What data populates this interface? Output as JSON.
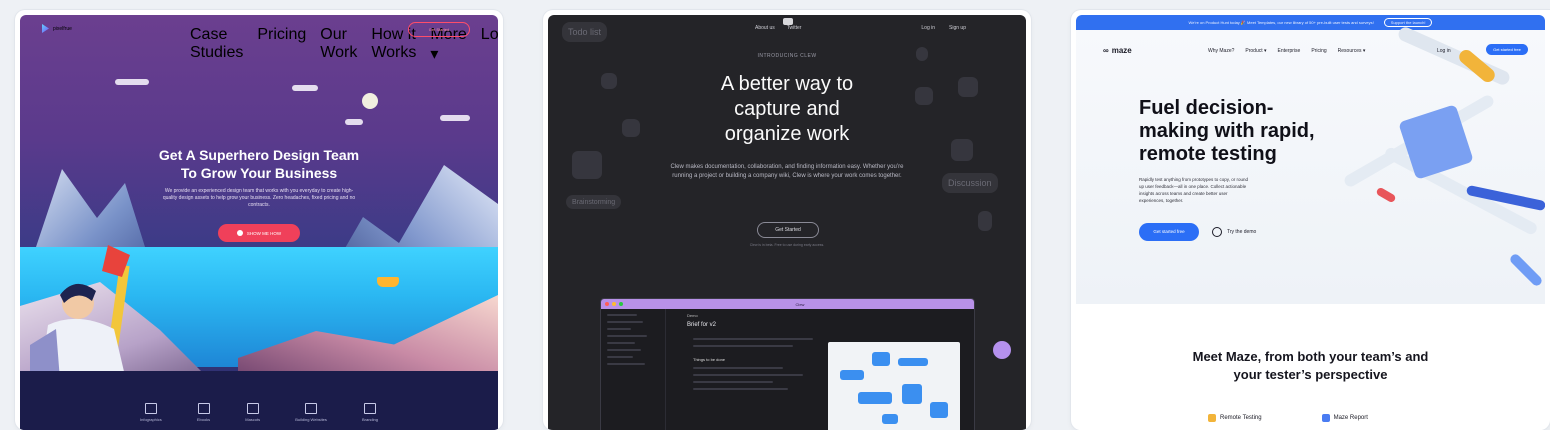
{
  "card1": {
    "logo": "pixelfrue",
    "nav": [
      "Case Studies",
      "Pricing",
      "Our Work",
      "How it Works",
      "More ▾",
      "Login"
    ],
    "nav_cta": "Get Started",
    "headline_1": "Get A Superhero Design Team",
    "headline_2": "To Grow Your Business",
    "subtext": "We provide an experienced design team that works with you everyday to create high-quality design assets to help grow your business. Zero headaches, fixed pricing and no contracts.",
    "cta": "SHOW ME HOW",
    "footer_items": [
      "Infographics",
      "Ebooks",
      "Mascots",
      "Building Websites",
      "Branding"
    ]
  },
  "card2": {
    "top_links": [
      "About us",
      "Twitter"
    ],
    "top_right": [
      "Log in",
      "Sign up"
    ],
    "intro": "INTRODUCING CLEW",
    "headline_1": "A better way to",
    "headline_2": "capture and",
    "headline_3": "organize work",
    "subtext": "Clew makes documentation, collaboration, and finding information easy. Whether you’re running a project or building a company wiki, Clew is where your work comes together.",
    "cta": "Get Started",
    "note": "Clew is in beta. Free to use during early access.",
    "float_pill_1": "Todo list",
    "float_pill_2": "Discussion",
    "float_pill_3": "Brainstorming",
    "app_title": "Clew",
    "app_brief": "Brief for v2",
    "app_subtitle": "Demo",
    "app_things": "Things to be done"
  },
  "card3": {
    "banner_text": "We’re on Product Hunt today 🎉 Meet Templates, our new library of 50+ pre-built user tests and surveys!",
    "banner_button": "Support the launch!",
    "logo": "maze",
    "nav": [
      "Why Maze?",
      "Product ▾",
      "Enterprise",
      "Pricing",
      "Resources ▾"
    ],
    "login": "Log in",
    "nav_cta": "Get started free",
    "headline_1": "Fuel decision-",
    "headline_2": "making with rapid,",
    "headline_3": "remote testing",
    "subtext": "Rapidly test anything from prototypes to copy, or round up user feedback—all in one place. Collect actionable insights across teams and create better user experiences, together.",
    "cta": "Get started free",
    "demo": "Try the demo",
    "section_title_1": "Meet Maze, from both your team’s and",
    "section_title_2": "your tester’s perspective",
    "tabs": [
      "Remote Testing",
      "Maze Report"
    ]
  }
}
